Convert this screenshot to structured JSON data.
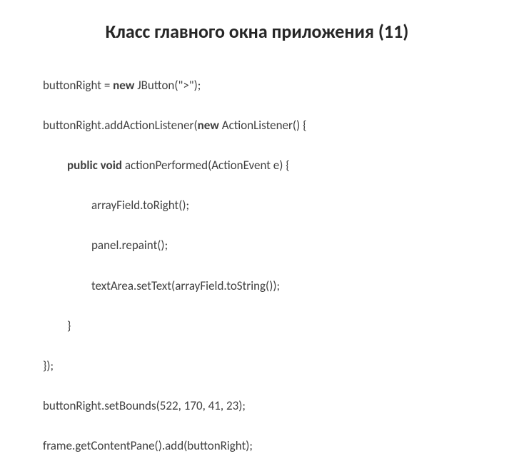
{
  "title": "Класс главного окна приложения (11)",
  "code": {
    "l1a": "buttonRight = ",
    "l1_kw": "new",
    "l1b": " JButton(\">\");",
    "l2a": "buttonRight.addActionListener(",
    "l2_kw": "new",
    "l2b": " ActionListener() {",
    "l3_kw": "public void",
    "l3b": " actionPerformed(ActionEvent e) {",
    "l4": "arrayField.toRight();",
    "l5": "panel.repaint();",
    "l6": "textArea.setText(arrayField.toString());",
    "l7": "}",
    "l8": "});",
    "l9": "buttonRight.setBounds(522, 170, 41, 23);",
    "l10": "frame.getContentPane().add(buttonRight);"
  }
}
